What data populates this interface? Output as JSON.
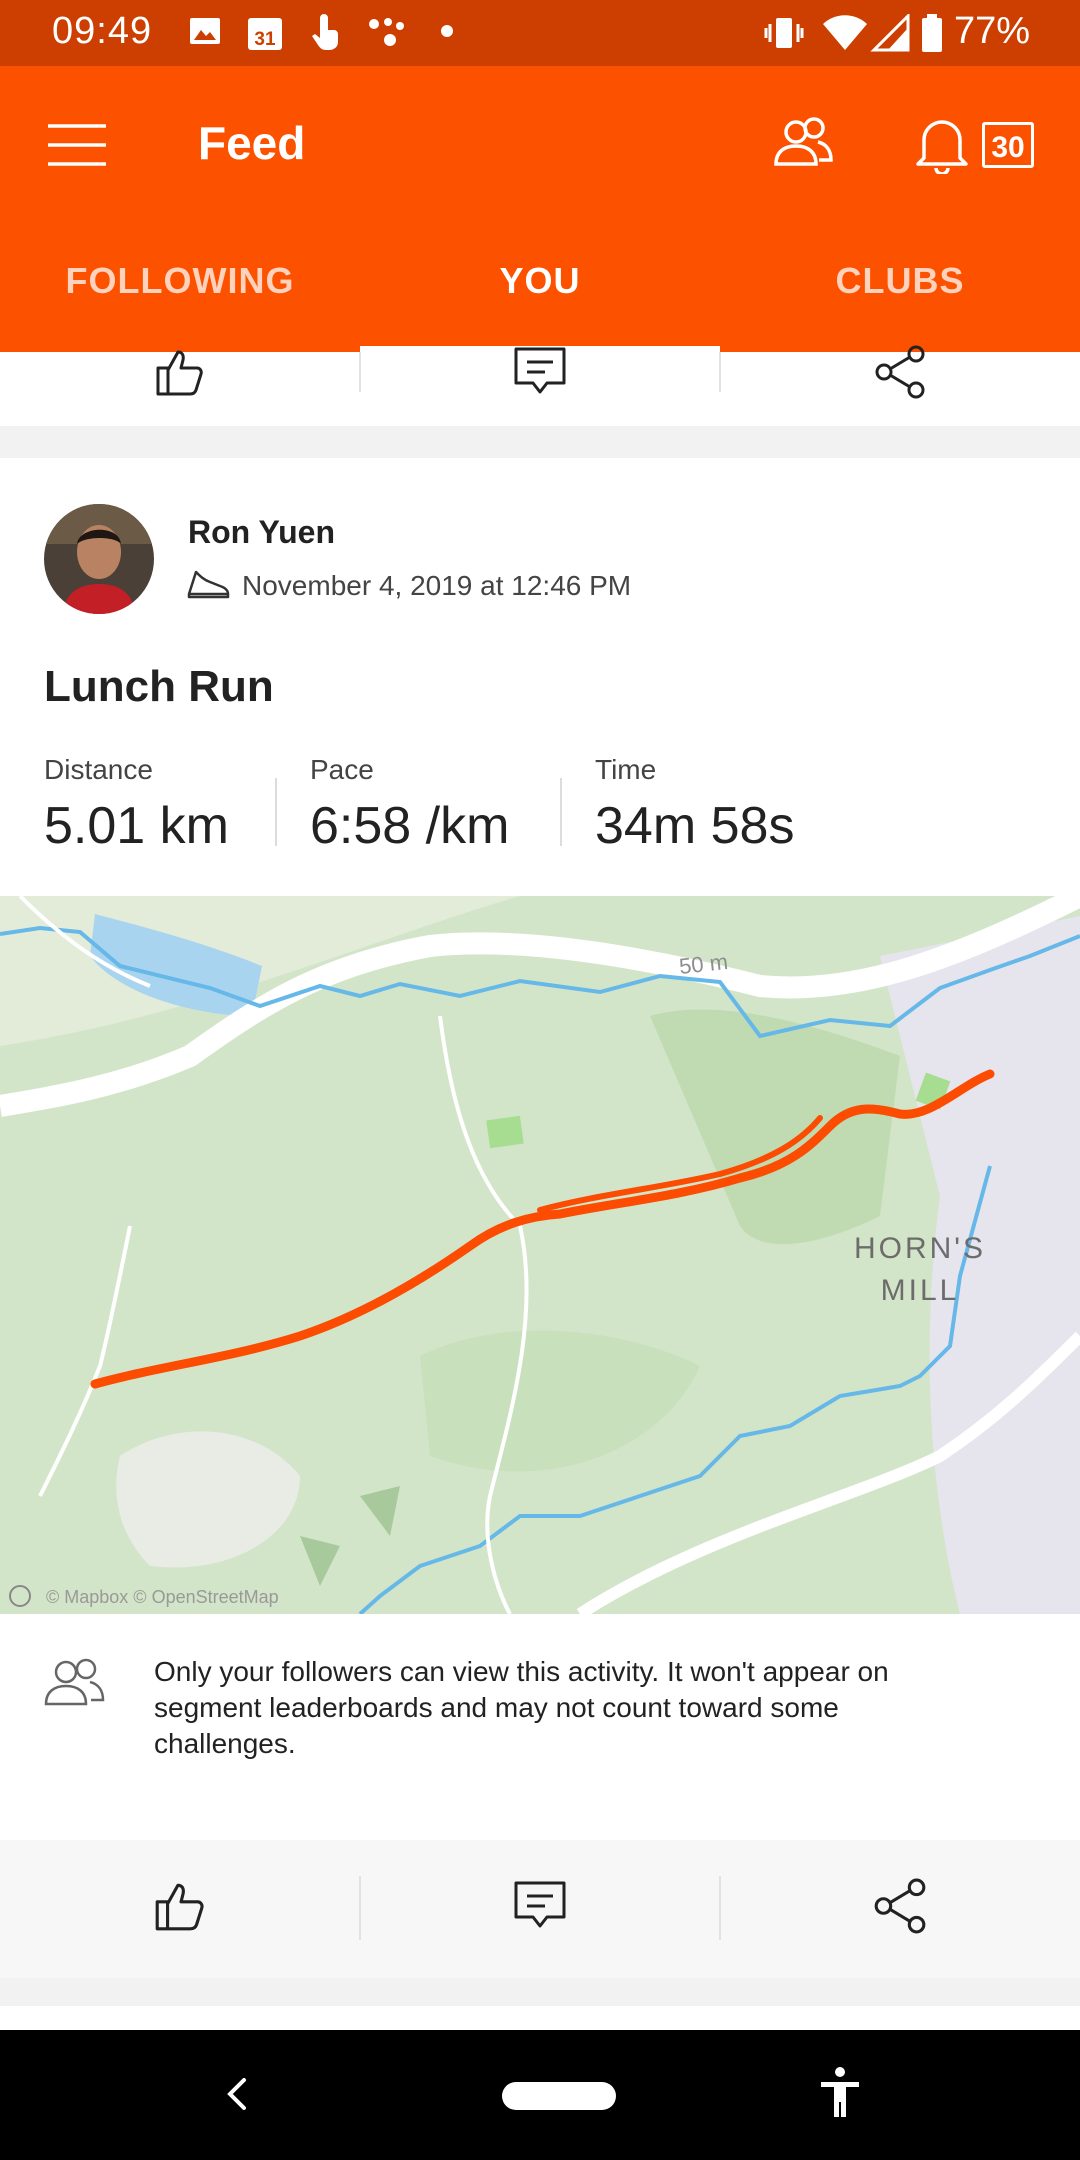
{
  "status_bar": {
    "time": "09:49",
    "calendar_day": "31",
    "battery": "77%"
  },
  "app_bar": {
    "title": "Feed",
    "notification_count": "30"
  },
  "tabs": [
    {
      "label": "FOLLOWING"
    },
    {
      "label": "YOU"
    },
    {
      "label": "CLUBS"
    }
  ],
  "activity": {
    "athlete_name": "Ron Yuen",
    "date_text": "November 4, 2019 at 12:46 PM",
    "title": "Lunch Run",
    "stats": [
      {
        "label": "Distance",
        "value": "5.01 km"
      },
      {
        "label": "Pace",
        "value": "6:58 /km"
      },
      {
        "label": "Time",
        "value": "34m 58s"
      }
    ],
    "map": {
      "place_label_line1": "HORN'S",
      "place_label_line2": "MILL",
      "elevation_label": "50 m",
      "attribution": "© Mapbox © OpenStreetMap",
      "route_color": "#fc4c02"
    },
    "privacy_note": "Only your followers can view this activity. It won't appear on segment leaderboards and may not count toward some challenges."
  },
  "colors": {
    "brand": "#fc5200",
    "status_bar": "#cc3f00"
  }
}
